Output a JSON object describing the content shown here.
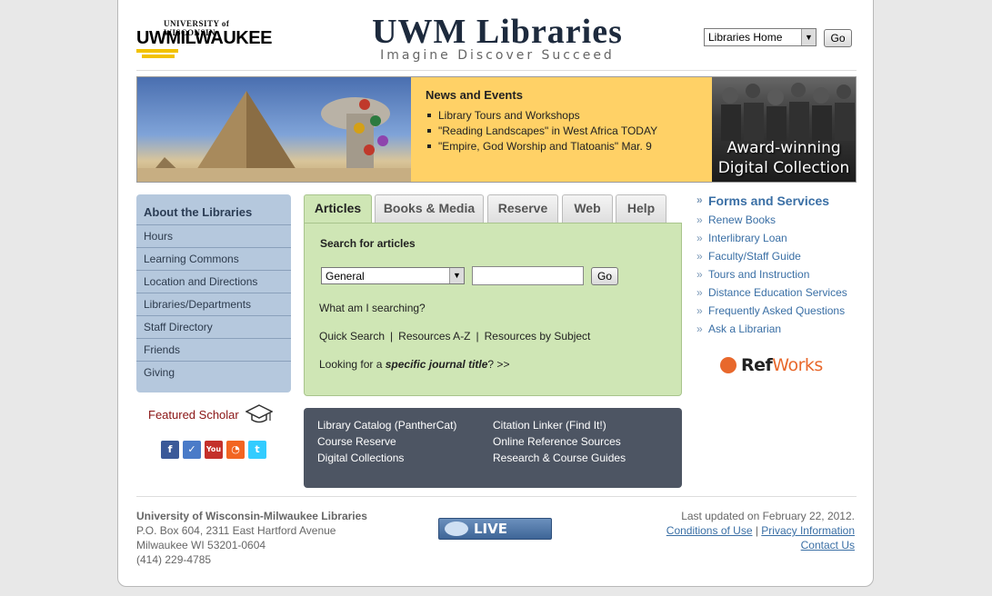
{
  "header": {
    "logo_university": "UNIVERSITY of WISCONSIN",
    "logo_campus": "UWMILWAUKEE",
    "title": "UWM Libraries",
    "tagline": "Imagine Discover Succeed",
    "library_select_value": "Libraries Home",
    "go_label": "Go"
  },
  "banner": {
    "news_title": "News and Events",
    "news_items": [
      "Library Tours and Workshops",
      "\"Reading Landscapes\" in West Africa TODAY",
      "\"Empire, God Worship and Tlatoanis\" Mar. 9"
    ],
    "award_line1": "Award-winning",
    "award_line2": "Digital Collection"
  },
  "sidebar": {
    "heading": "About the Libraries",
    "items": [
      "Hours",
      "Learning Commons",
      "Location and Directions",
      "Libraries/Departments",
      "Staff Directory",
      "Friends",
      "Giving"
    ],
    "featured_scholar": "Featured Scholar",
    "social_icons": [
      "facebook-icon",
      "foursquare-icon",
      "youtube-icon",
      "rss-icon",
      "twitter-icon"
    ]
  },
  "search": {
    "tabs": [
      "Articles",
      "Books & Media",
      "Reserve",
      "Web",
      "Help"
    ],
    "active_tab": "Articles",
    "label": "Search for articles",
    "scope_value": "General",
    "input_value": "",
    "go_label": "Go",
    "what_searching": "What am I searching?",
    "quick_search": "Quick Search",
    "resources_az": "Resources A-Z",
    "resources_subject": "Resources by Subject",
    "journal_prefix": "Looking for a ",
    "journal_bold": "specific journal title",
    "journal_suffix": "? >>"
  },
  "dark_box": {
    "links": [
      "Library Catalog (PantherCat)",
      "Course Reserve",
      "Digital Collections",
      "Citation Linker (Find It!)",
      "Online Reference Sources",
      "Research & Course Guides"
    ]
  },
  "services": {
    "title": "Forms and Services",
    "items": [
      "Renew Books",
      "Interlibrary Loan",
      "Faculty/Staff Guide",
      "Tours and Instruction",
      "Distance Education Services",
      "Frequently Asked Questions",
      "Ask a Librarian"
    ],
    "refworks_ref": "Ref",
    "refworks_works": "Works"
  },
  "footer": {
    "org": "University of Wisconsin-Milwaukee Libraries",
    "address1": "P.O. Box 604, 2311 East Hartford Avenue",
    "address2": "Milwaukee WI 53201-0604",
    "phone": "(414) 229-4785",
    "live_help": "LIVE HELP",
    "updated": "Last updated on February 22, 2012.",
    "conditions": "Conditions of Use",
    "privacy": "Privacy Information",
    "contact": "Contact Us"
  },
  "colors": {
    "accent_link": "#3a6fa5",
    "news_bg": "#ffd166",
    "sidebar_bg": "#b5c8dd",
    "tab_panel_bg": "#cfe6b5",
    "dark_box_bg": "#4d5563"
  }
}
